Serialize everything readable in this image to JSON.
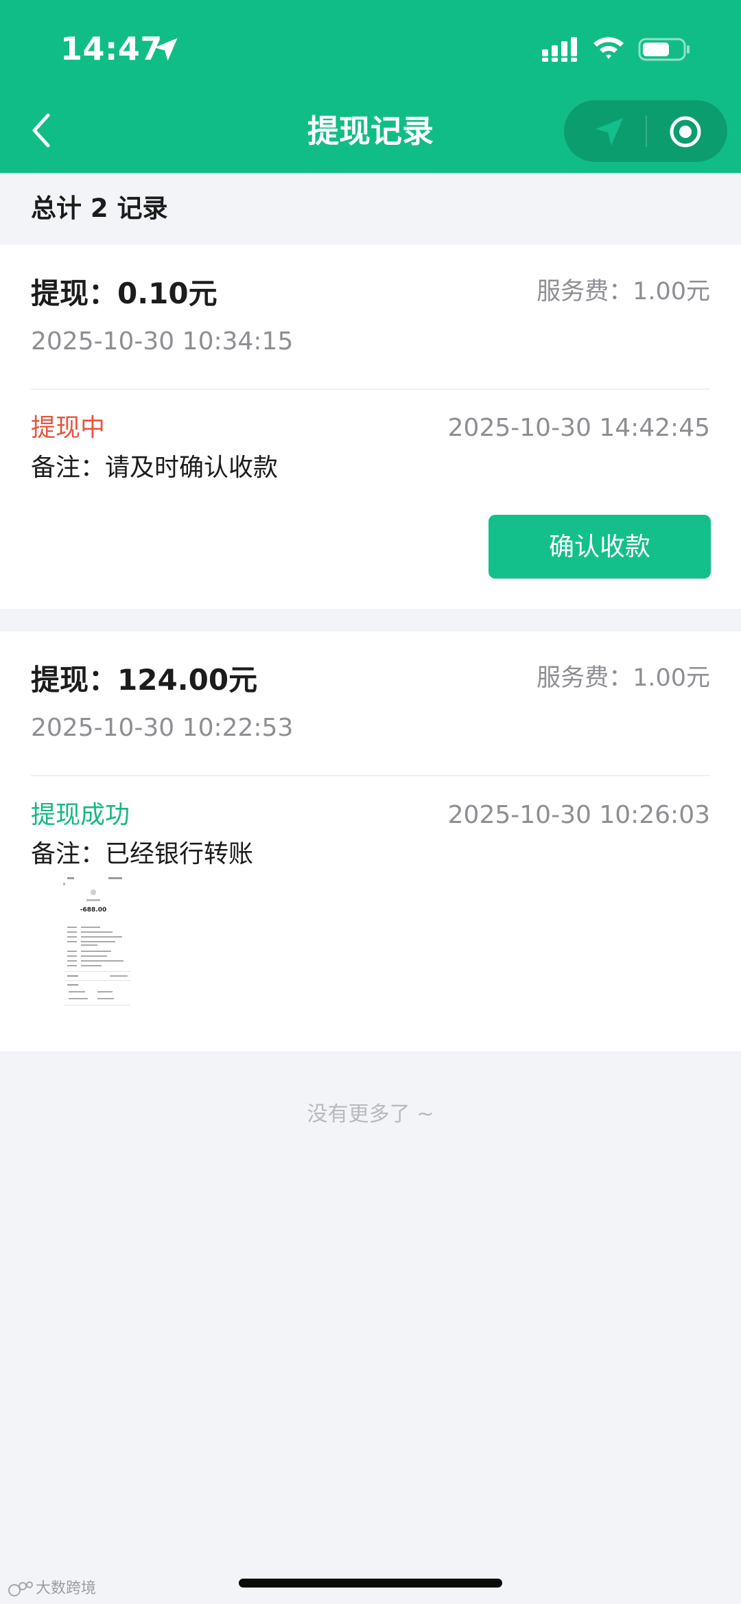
{
  "status_bar": {
    "time": "14:47",
    "icons": [
      "location-arrow-icon",
      "cellular-signal-icon",
      "wifi-icon",
      "battery-icon"
    ]
  },
  "nav": {
    "back_icon": "chevron-left-icon",
    "title": "提现记录",
    "capsule_icons": [
      "navigation-arrow-icon",
      "target-circle-icon"
    ]
  },
  "summary": "总计 2 记录",
  "records": [
    {
      "amount": "提现：0.10元",
      "fee": "服务费：1.00元",
      "created_at": "2025-10-30 10:34:15",
      "status": "提现中",
      "status_color": "#e8533e",
      "updated_at": "2025-10-30 14:42:45",
      "note": "备注：请及时确认收款",
      "action_label": "确认收款"
    },
    {
      "amount": "提现：124.00元",
      "fee": "服务费：1.00元",
      "created_at": "2025-10-30 10:22:53",
      "status": "提现成功",
      "status_color": "#16b883",
      "updated_at": "2025-10-30 10:26:03",
      "note": "备注：已经银行转账",
      "attachment": {
        "amount": "-688.00"
      }
    }
  ],
  "footer": "没有更多了 ~",
  "watermark": "大数跨境",
  "colors": {
    "brand": "#11bd87",
    "background": "#f3f4f8",
    "status_pending": "#e8533e",
    "status_success": "#16b883"
  }
}
